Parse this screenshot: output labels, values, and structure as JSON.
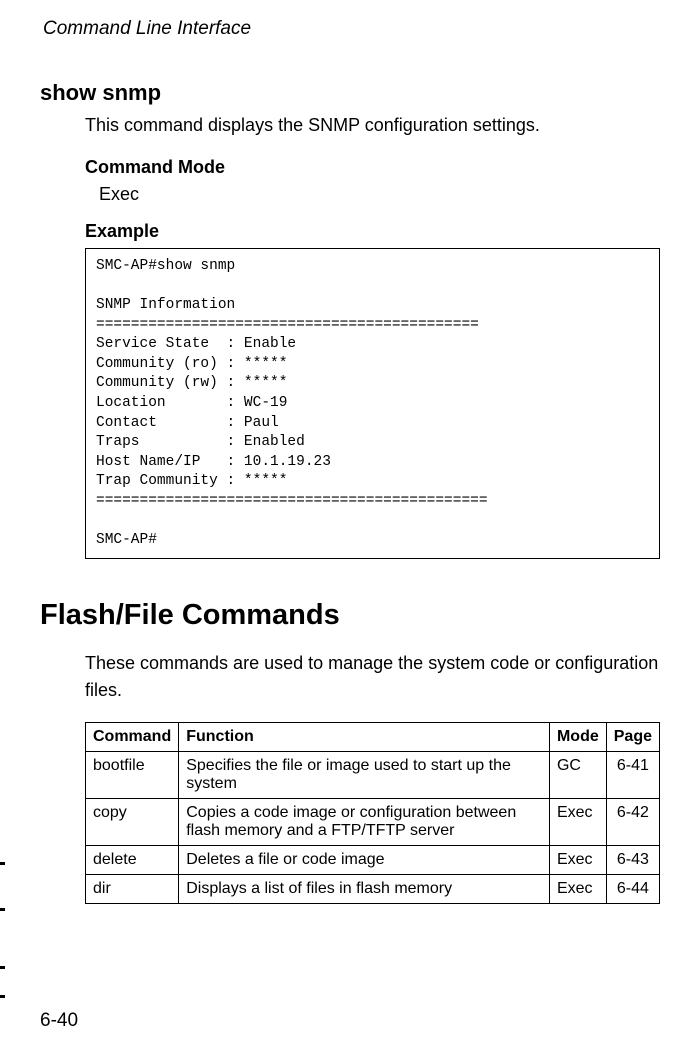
{
  "running_header": "Command Line Interface",
  "page_number": "6-40",
  "section1": {
    "title": "show snmp",
    "description": "This command displays the SNMP configuration settings.",
    "command_mode_label": "Command Mode",
    "command_mode_value": "Exec",
    "example_label": "Example",
    "code": "SMC-AP#show snmp\n\nSNMP Information\n============================================\nService State  : Enable\nCommunity (ro) : *****\nCommunity (rw) : *****\nLocation       : WC-19\nContact        : Paul\nTraps          : Enabled\nHost Name/IP   : 10.1.19.23\nTrap Community : *****\n=============================================\n\nSMC-AP#"
  },
  "section2": {
    "title": "Flash/File Commands",
    "description": "These commands are used to manage the system code or configuration files.",
    "table": {
      "headers": {
        "command": "Command",
        "function": "Function",
        "mode": "Mode",
        "page": "Page"
      },
      "rows": [
        {
          "command": "bootfile",
          "function": "Specifies the file or image used to start up the system",
          "mode": "GC",
          "page": "6-41"
        },
        {
          "command": "copy",
          "function": "Copies a code image or configuration between flash memory and a FTP/TFTP server",
          "mode": "Exec",
          "page": "6-42"
        },
        {
          "command": "delete",
          "function": "Deletes a file or code image",
          "mode": "Exec",
          "page": "6-43"
        },
        {
          "command": "dir",
          "function": "Displays a list of files in flash memory",
          "mode": "Exec",
          "page": "6-44"
        }
      ]
    }
  }
}
